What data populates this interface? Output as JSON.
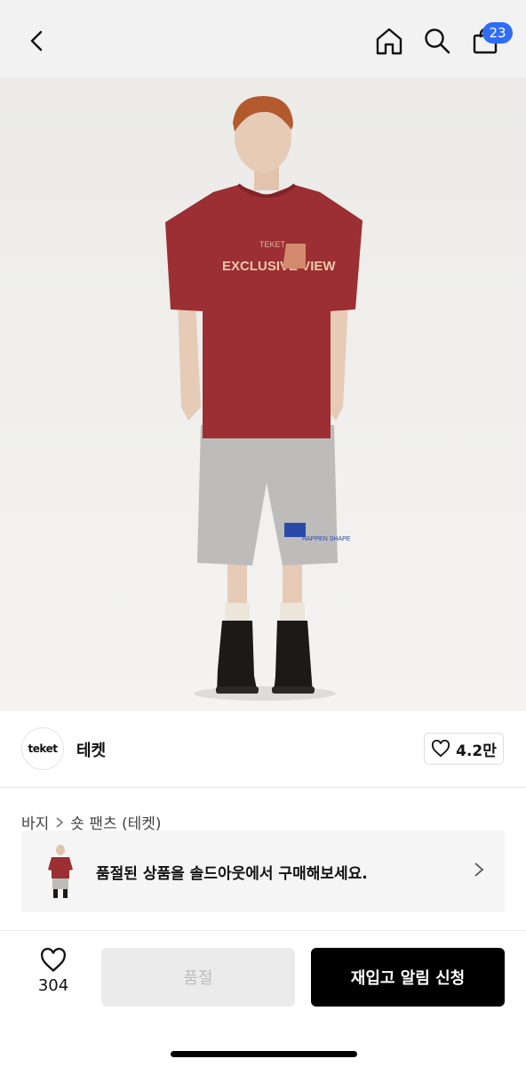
{
  "header": {
    "back_icon": "chevron-left-icon",
    "home_icon": "home-icon",
    "search_icon": "search-icon",
    "bag_icon": "shopping-bag-icon",
    "cart_count": "23",
    "badge_color": "#2f6df6"
  },
  "product_image": {
    "shirt_text_top": "TEKET",
    "shirt_text_main": "EXCLUSIVE VIEW",
    "shorts_text": "HAPPEN SHAPE"
  },
  "brand": {
    "logo_text": "teket",
    "name": "테켓",
    "like_icon": "heart-icon",
    "like_count": "4.2만"
  },
  "breadcrumb": {
    "items": [
      "바지",
      "숏 팬츠 (테켓)"
    ],
    "separator_icon": "chevron-right-icon"
  },
  "soldout_banner": {
    "text": "품절된 상품을 솔드아웃에서 구매해보세요.",
    "chevron_icon": "chevron-right-icon"
  },
  "bottom_bar": {
    "like_icon": "heart-icon",
    "like_count": "304",
    "soldout_label": "품절",
    "restock_label": "재입고 알림 신청"
  },
  "colors": {
    "primary_button": "#000000",
    "disabled_button": "#ebebeb"
  }
}
